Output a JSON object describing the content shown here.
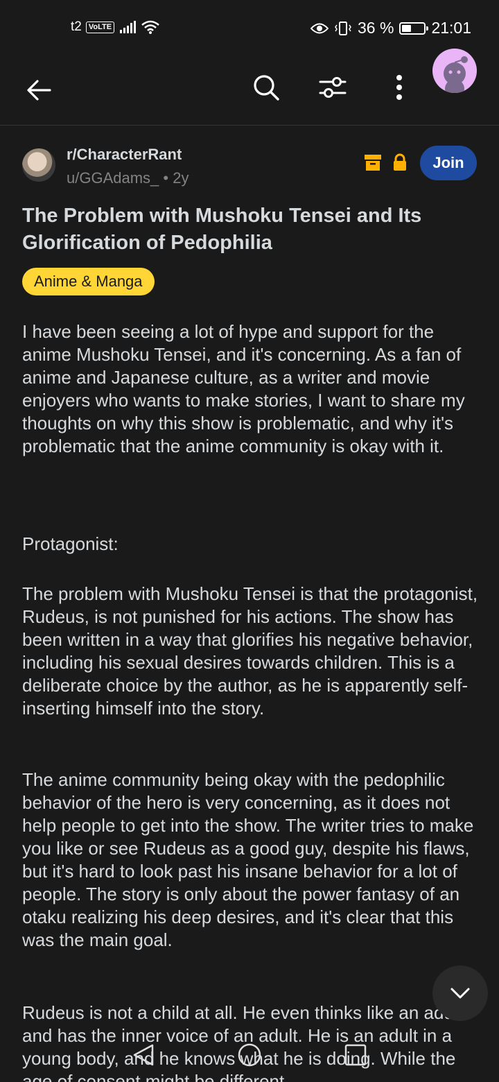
{
  "status_bar": {
    "carrier": "t2",
    "volte": "VoLTE",
    "battery": "36 %",
    "time": "21:01"
  },
  "post": {
    "subreddit": "r/CharacterRant",
    "author": "u/GGAdams_",
    "age": "• 2y",
    "join_label": "Join",
    "title": "The Problem with Mushoku Tensei and Its Glorification of Pedophilia",
    "flair": "Anime & Manga",
    "body": [
      "I have been seeing a lot of hype and support for the anime Mushoku Tensei, and it's concerning. As a fan of anime and Japanese culture, as a writer and movie enjoyers who wants to make stories, I want to share my thoughts on why this show is problematic, and why it's problematic that the anime community is okay with it.",
      "Protagonist:",
      "The problem with Mushoku Tensei is that the protagonist, Rudeus, is not punished for his actions. The show has been written in a way that glorifies his negative behavior, including his sexual desires towards children. This is a deliberate choice by the author, as he is apparently self-inserting himself into the story.",
      "The anime community being okay with the pedophilic behavior of the hero is very concerning, as it does not help people to get into the show. The writer tries to make you like or see Rudeus as a good guy, despite his flaws, but it's hard to look past his insane behavior for a lot of people. The story is only about the power fantasy of an otaku realizing his deep desires, and it's clear that this was the main goal.",
      "Rudeus is not a child at all. He even thinks like an adult and has the inner voice of an adult. He is an adult in a young body, and he knows what he is doing. While the age of consent might be different"
    ]
  },
  "icons": {
    "back": "back-arrow-icon",
    "search": "search-icon",
    "filter": "filter-icon",
    "more": "more-vertical-icon",
    "archive": "archive-icon",
    "lock": "lock-icon",
    "scroll": "chevron-down-icon"
  },
  "colors": {
    "background": "#1a1a1b",
    "join": "#1e4ba0",
    "flair": "#ffd635",
    "icon_accent": "#ffb000",
    "avatar_bg": "#e9b5f6"
  }
}
